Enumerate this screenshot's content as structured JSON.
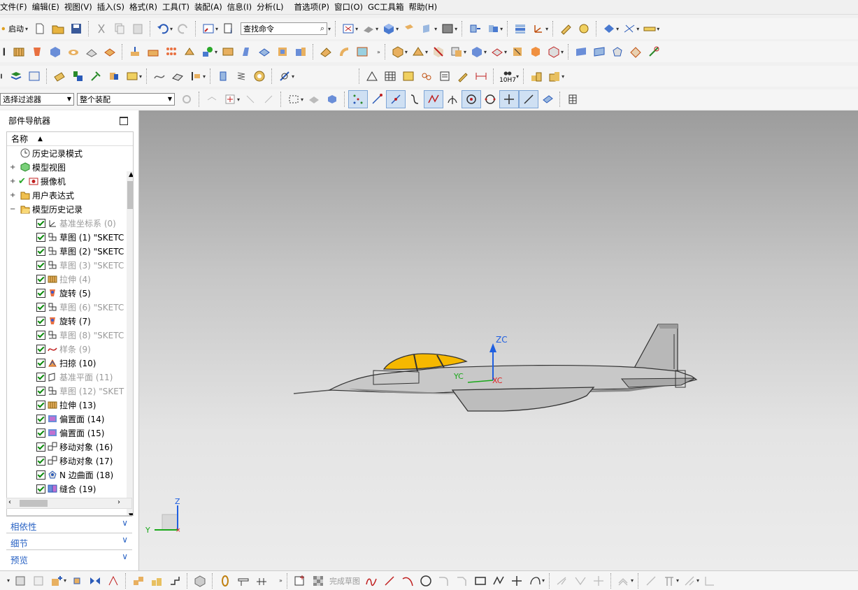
{
  "menubar": {
    "items": [
      "文件(F)",
      "编辑(E)",
      "视图(V)",
      "插入(S)",
      "格式(R)",
      "工具(T)",
      "装配(A)",
      "信息(I)",
      "分析(L)",
      "首选项(P)",
      "窗口(O)",
      "GC工具箱",
      "帮助(H)"
    ]
  },
  "toolbar": {
    "start_label": "启动",
    "command_search_placeholder": "查找命令",
    "selection_filter": "选择过滤器",
    "assembly_scope": "整个装配",
    "fit_code": "10H7"
  },
  "navigator": {
    "title": "部件导航器",
    "column_name": "名称",
    "top_items": [
      {
        "label": "历史记录模式",
        "icon": "clock-icon"
      },
      {
        "label": "模型视图",
        "icon": "model-views-icon"
      },
      {
        "label": "摄像机",
        "icon": "camera-icon"
      },
      {
        "label": "用户表达式",
        "icon": "folder-icon"
      },
      {
        "label": "模型历史记录",
        "icon": "folder-open-icon"
      }
    ],
    "features": [
      {
        "label": "基准坐标系 (0)",
        "icon": "datum-csys-icon",
        "grey": true
      },
      {
        "label": "草图 (1) \"SKETC",
        "icon": "sketch-icon",
        "grey": false
      },
      {
        "label": "草图 (2) \"SKETC",
        "icon": "sketch-icon",
        "grey": false
      },
      {
        "label": "草图 (3) \"SKETC",
        "icon": "sketch-icon",
        "grey": true
      },
      {
        "label": "拉伸 (4)",
        "icon": "extrude-icon",
        "grey": true
      },
      {
        "label": "旋转 (5)",
        "icon": "revolve-icon",
        "grey": false
      },
      {
        "label": "草图 (6) \"SKETC",
        "icon": "sketch-icon",
        "grey": true
      },
      {
        "label": "旋转 (7)",
        "icon": "revolve-icon",
        "grey": false
      },
      {
        "label": "草图 (8) \"SKETC",
        "icon": "sketch-icon",
        "grey": true
      },
      {
        "label": "样条 (9)",
        "icon": "spline-icon",
        "grey": true
      },
      {
        "label": "扫掠 (10)",
        "icon": "swept-icon",
        "grey": false
      },
      {
        "label": "基准平面 (11)",
        "icon": "datum-plane-icon",
        "grey": true
      },
      {
        "label": "草图 (12) \"SKET",
        "icon": "sketch-icon",
        "grey": true
      },
      {
        "label": "拉伸 (13)",
        "icon": "extrude-icon",
        "grey": false
      },
      {
        "label": "偏置面 (14)",
        "icon": "offset-face-icon",
        "grey": false
      },
      {
        "label": "偏置面 (15)",
        "icon": "offset-face-icon",
        "grey": false
      },
      {
        "label": "移动对象 (16)",
        "icon": "move-object-icon",
        "grey": false
      },
      {
        "label": "移动对象 (17)",
        "icon": "move-object-icon",
        "grey": false
      },
      {
        "label": "N 边曲面 (18)",
        "icon": "n-sided-surface-icon",
        "grey": false
      },
      {
        "label": "缝合 (19)",
        "icon": "sew-icon",
        "grey": false
      }
    ],
    "sections": [
      "相依性",
      "细节",
      "预览"
    ]
  },
  "viewport": {
    "wcs_labels": {
      "zc": "ZC",
      "xc": "XC",
      "yc": "YC"
    },
    "triad_labels": {
      "z": "Z",
      "y": "Y"
    }
  },
  "bottombar": {
    "finish_sketch": "完成草图"
  },
  "colors": {
    "canopy": "#f5b800",
    "fuselage": "#c8c8c8",
    "zc_axis": "#1f5fe0",
    "xc_axis": "#e02020",
    "yc_axis": "#1aa81a",
    "section_text": "#2a63c4"
  }
}
